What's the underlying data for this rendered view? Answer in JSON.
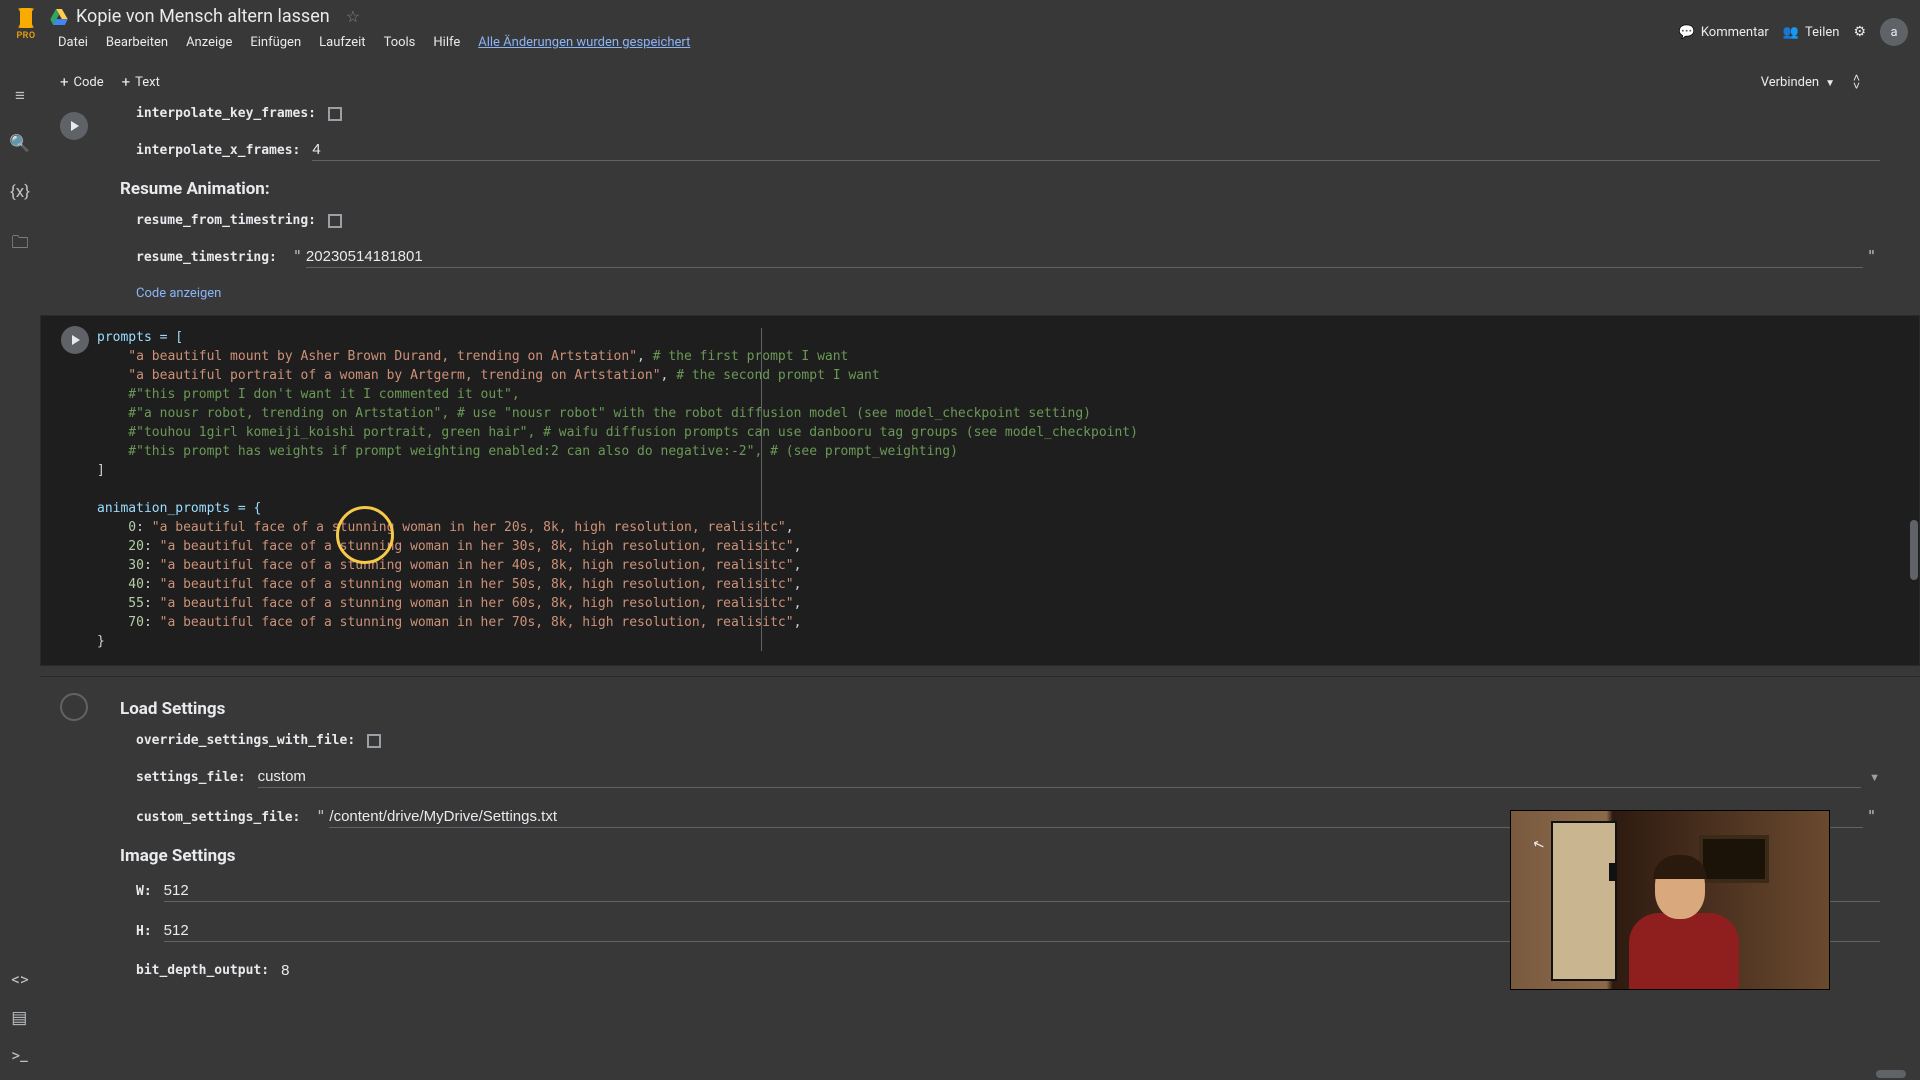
{
  "header": {
    "pro": "PRO",
    "title": "Kopie von Mensch altern lassen",
    "menus": [
      "Datei",
      "Bearbeiten",
      "Anzeige",
      "Einfügen",
      "Laufzeit",
      "Tools",
      "Hilfe"
    ],
    "saved": "Alle Änderungen wurden gespeichert",
    "comment": "Kommentar",
    "share": "Teilen",
    "avatar": "a"
  },
  "toolbar": {
    "code": "Code",
    "text": "Text",
    "connect": "Verbinden"
  },
  "cell1": {
    "interp_key": "interpolate_key_frames:",
    "interp_x": "interpolate_x_frames:",
    "interp_x_val": "4",
    "resume_head": "Resume Animation:",
    "resume_from": "resume_from_timestring:",
    "resume_ts_label": "resume_timestring:",
    "resume_ts_val": "20230514181801",
    "showcode": "Code anzeigen"
  },
  "code": {
    "l1": "prompts = [",
    "l2a": "    \"a beautiful mount by Asher Brown Durand, trending on Artstation\"",
    "l2b": ", ",
    "l2c": "# the first prompt I want",
    "l3a": "    \"a beautiful portrait of a woman by Artgerm, trending on Artstation\"",
    "l3b": ", ",
    "l3c": "# the second prompt I want",
    "l4": "    #\"this prompt I don't want it I commented it out\",",
    "l5": "    #\"a nousr robot, trending on Artstation\", # use \"nousr robot\" with the robot diffusion model (see model_checkpoint setting)",
    "l6": "    #\"touhou 1girl komeiji_koishi portrait, green hair\", # waifu diffusion prompts can use danbooru tag groups (see model_checkpoint)",
    "l7": "    #\"this prompt has weights if prompt weighting enabled:2 can also do negative:-2\", # (see prompt_weighting)",
    "l8": "]",
    "l9": "",
    "l10": "animation_prompts = {",
    "l11a": "    0",
    "l11b": ": ",
    "l11c": "\"a beautiful face of a stunning woman in her 20s, 8k, high resolution, realisitc\"",
    "l11d": ",",
    "l12a": "    20",
    "l12b": ": ",
    "l12c": "\"a beautiful face of a stunning woman in her 30s, 8k, high resolution, realisitc\"",
    "l12d": ",",
    "l13a": "    30",
    "l13b": ": ",
    "l13c": "\"a beautiful face of a stunning woman in her 40s, 8k, high resolution, realisitc\"",
    "l13d": ",",
    "l14a": "    40",
    "l14b": ": ",
    "l14c": "\"a beautiful face of a stunning woman in her 50s, 8k, high resolution, realisitc\"",
    "l14d": ",",
    "l15a": "    55",
    "l15b": ": ",
    "l15c": "\"a beautiful face of a stunning woman in her 60s, 8k, high resolution, realisitc\"",
    "l15d": ",",
    "l16a": "    70",
    "l16b": ": ",
    "l16c": "\"a beautiful face of a stunning woman in her 70s, 8k, high resolution, realisitc\"",
    "l16d": ",",
    "l17": "}"
  },
  "cell3": {
    "load_head": "Load Settings",
    "override": "override_settings_with_file:",
    "settings_file_label": "settings_file:",
    "settings_file_val": "custom",
    "custom_label": "custom_settings_file:",
    "custom_val": "/content/drive/MyDrive/Settings.txt",
    "image_head": "Image Settings",
    "w_label": "W:",
    "w_val": "512",
    "h_label": "H:",
    "h_val": "512",
    "bit_label": "bit_depth_output:",
    "bit_val": "8"
  }
}
